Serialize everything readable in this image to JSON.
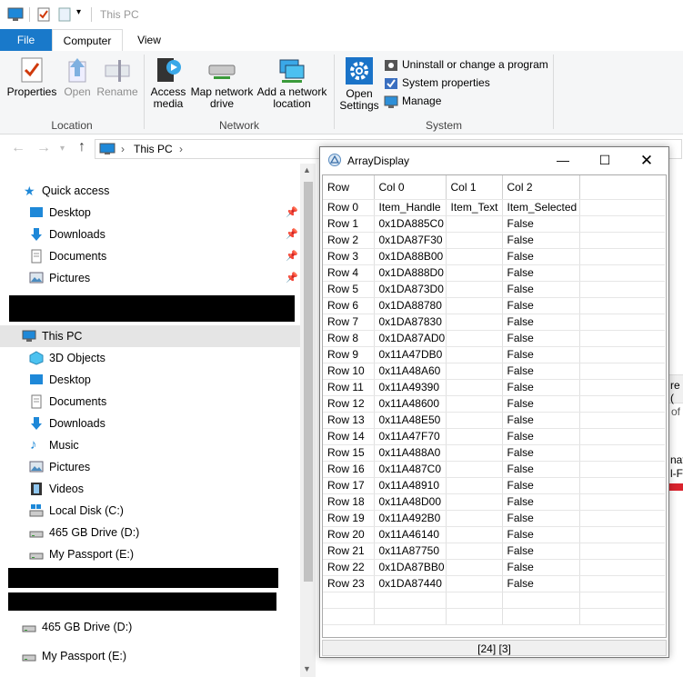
{
  "window": {
    "title": "This PC"
  },
  "tabs": {
    "file": "File",
    "computer": "Computer",
    "view": "View"
  },
  "ribbon": {
    "location": {
      "label": "Location",
      "properties": "Properties",
      "open": "Open",
      "rename": "Rename"
    },
    "network": {
      "label": "Network",
      "access_media": "Access media",
      "map_network_drive": "Map network drive",
      "add_network_location": "Add a network location"
    },
    "system": {
      "label": "System",
      "open_settings": "Open Settings",
      "uninstall": "Uninstall or change a program",
      "system_properties": "System properties",
      "manage": "Manage"
    }
  },
  "address": {
    "path": "This PC"
  },
  "nav": {
    "quick_access": "Quick access",
    "quick_items": [
      "Desktop",
      "Downloads",
      "Documents",
      "Pictures"
    ],
    "this_pc": "This PC",
    "pc_items": [
      "3D Objects",
      "Desktop",
      "Documents",
      "Downloads",
      "Music",
      "Pictures",
      "Videos",
      "Local Disk (C:)",
      "465 GB Drive (D:)",
      "My Passport (E:)"
    ],
    "extra_items": [
      "465 GB Drive (D:)",
      "My Passport (E:)"
    ]
  },
  "background_fragments": {
    "frag1": "re (",
    "frag2": "of",
    "frag3": "nati",
    "frag4": "l-F"
  },
  "array_display": {
    "title": "ArrayDisplay",
    "headers": [
      "Row",
      "Col 0",
      "Col 1",
      "Col 2"
    ],
    "rows": [
      [
        "Row 0",
        "Item_Handle",
        "Item_Text",
        "Item_Selected"
      ],
      [
        "Row 1",
        "0x1DA885C0",
        "",
        "False"
      ],
      [
        "Row 2",
        "0x1DA87F30",
        "",
        "False"
      ],
      [
        "Row 3",
        "0x1DA88B00",
        "",
        "False"
      ],
      [
        "Row 4",
        "0x1DA888D0",
        "",
        "False"
      ],
      [
        "Row 5",
        "0x1DA873D0",
        "",
        "False"
      ],
      [
        "Row 6",
        "0x1DA88780",
        "",
        "False"
      ],
      [
        "Row 7",
        "0x1DA87830",
        "",
        "False"
      ],
      [
        "Row 8",
        "0x1DA87AD0",
        "",
        "False"
      ],
      [
        "Row 9",
        "0x11A47DB0",
        "",
        "False"
      ],
      [
        "Row 10",
        "0x11A48A60",
        "",
        "False"
      ],
      [
        "Row 11",
        "0x11A49390",
        "",
        "False"
      ],
      [
        "Row 12",
        "0x11A48600",
        "",
        "False"
      ],
      [
        "Row 13",
        "0x11A48E50",
        "",
        "False"
      ],
      [
        "Row 14",
        "0x11A47F70",
        "",
        "False"
      ],
      [
        "Row 15",
        "0x11A488A0",
        "",
        "False"
      ],
      [
        "Row 16",
        "0x11A487C0",
        "",
        "False"
      ],
      [
        "Row 17",
        "0x11A48910",
        "",
        "False"
      ],
      [
        "Row 18",
        "0x11A48D00",
        "",
        "False"
      ],
      [
        "Row 19",
        "0x11A492B0",
        "",
        "False"
      ],
      [
        "Row 20",
        "0x11A46140",
        "",
        "False"
      ],
      [
        "Row 21",
        "0x11A87750",
        "",
        "False"
      ],
      [
        "Row 22",
        "0x1DA87BB0",
        "",
        "False"
      ],
      [
        "Row 23",
        "0x1DA87440",
        "",
        "False"
      ]
    ],
    "status": "[24] [3]"
  },
  "colors": {
    "accent": "#1979ca",
    "selection": "#e5e5e5",
    "redaction": "#000000"
  }
}
